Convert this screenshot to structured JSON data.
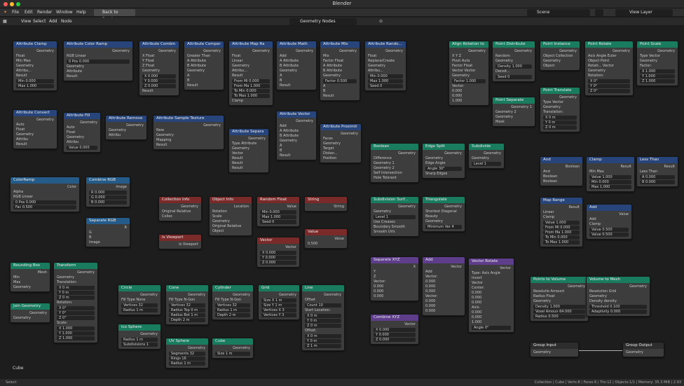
{
  "window": {
    "title": "Blender"
  },
  "menubar": {
    "items": [
      "File",
      "Edit",
      "Render",
      "Window",
      "Help"
    ],
    "back_button": "Back to Previous",
    "scene": "Scene",
    "view_layer": "View Layer"
  },
  "editor": {
    "menus": [
      "View",
      "Select",
      "Add",
      "Node"
    ],
    "node_tree": "Geometry Nodes"
  },
  "canvas": {
    "object_label": "Cube"
  },
  "status": {
    "left": "Select",
    "right": "Collection | Cube | Verts:8 | Faces:6 | Tris:12 | Objects:1/1 | Memory: 35.3 MiB | 2.93"
  },
  "nodes": [
    {
      "title": "Attribute Clamp",
      "type": "attr",
      "rows": [
        "Geometry",
        "Float",
        "Min Max",
        "Geometry",
        "Attribu...",
        "Result",
        "Min  0.000",
        "Max  1.000"
      ]
    },
    {
      "title": "Attribute Color Ramp",
      "type": "attr",
      "rows": [
        "Geometry",
        "RGB  Linear",
        "0  Pos  0.000",
        "Geometry",
        "Attribute",
        "Result"
      ]
    },
    {
      "title": "Attribute Combin",
      "type": "attr",
      "rows": [
        "Geometry",
        "X  Float",
        "Y  Float",
        "Z  Float",
        "Geometry",
        "X  0.000",
        "Y  0.000",
        "Z  0.000",
        "Result"
      ]
    },
    {
      "title": "Attribute Compar",
      "type": "attr",
      "rows": [
        "Geometry",
        "Greater Than",
        "A  Attribute",
        "B  Attribute",
        "Geometry",
        "A",
        "B",
        "Result"
      ]
    },
    {
      "title": "Attribute Map Ra",
      "type": "attr",
      "rows": [
        "Geometry",
        "Float",
        "Linear",
        "Geometry",
        "Attribu...",
        "Result",
        "From Mi  0.000",
        "From Ma  1.000",
        "To Min  0.000",
        "To Max  1.000",
        "Clamp"
      ]
    },
    {
      "title": "Attribute Math",
      "type": "attr",
      "rows": [
        "Geometry",
        "Add",
        "A  Attribute",
        "B  Attribute",
        "Geometry",
        "A",
        "B",
        "Result"
      ]
    },
    {
      "title": "Attribute Mix",
      "type": "attr",
      "rows": [
        "Geometry",
        "Mix",
        "Factor  Float",
        "A  Attribute",
        "B  Attribute",
        "Geometry",
        "Factor  0.500",
        "A",
        "B",
        "Result"
      ]
    },
    {
      "title": "Attribute Rando...",
      "type": "attr",
      "rows": [
        "Geometry",
        "Float",
        "Replace/Create",
        "Geometry",
        "Attribu...",
        "Min  0.000",
        "Max  1.000",
        "Seed  0"
      ]
    },
    {
      "title": "Align Rotation to",
      "type": "geo",
      "rows": [
        "Geometry",
        "X  Y  Z",
        "Pivot  Auto",
        "Factor  Float",
        "Vector  Vector",
        "Geometry",
        "Factor  1.000",
        "Vector:",
        "0.000",
        "0.000",
        "1.000"
      ]
    },
    {
      "title": "Point Distribute",
      "type": "geo",
      "rows": [
        "Geometry",
        "Random",
        "Geometry",
        "Density  1.000",
        "Densit...",
        "Seed  0"
      ]
    },
    {
      "title": "Point Instance",
      "type": "geo",
      "rows": [
        "Geometry",
        "Object  Collection",
        "Geometry",
        "Object"
      ]
    },
    {
      "title": "Point Rotate",
      "type": "geo",
      "rows": [
        "Geometry",
        "Axis Angle  Euler",
        "Object  Point",
        "Rotati...  Vector",
        "Geometry",
        "Rotation:",
        "X  0°",
        "Y  0°",
        "Z  0°"
      ]
    },
    {
      "title": "Point Scale",
      "type": "geo",
      "rows": [
        "Geometry",
        "Type  Vector",
        "Geometry",
        "Factor:",
        "X  1.000",
        "Y  1.000",
        "Z  1.000"
      ]
    },
    {
      "title": "Point Translate",
      "type": "geo",
      "rows": [
        "Geometry",
        "Type  Vector",
        "Geometry",
        "Translation:",
        "X  0 m",
        "Y  0 m",
        "Z  0 m"
      ]
    },
    {
      "title": "Point Separate",
      "type": "geo",
      "rows": [
        "Geometry 1",
        "Geometry 2",
        "Geometry",
        "Mask"
      ]
    },
    {
      "title": "Attribute Convert",
      "type": "attr",
      "rows": [
        "Geometry",
        "Auto",
        "Float",
        "Geometry",
        "Attribu",
        "Result"
      ]
    },
    {
      "title": "Attribute Fill",
      "type": "attr",
      "rows": [
        "Geometry",
        "Auto",
        "Float",
        "Geometry",
        "Attribu",
        "Value  0.000"
      ]
    },
    {
      "title": "Attribute Remove",
      "type": "attr",
      "rows": [
        "Geometry",
        "Geometry",
        "Attribu"
      ]
    },
    {
      "title": "Attribute Sample Texture",
      "type": "attr",
      "rows": [
        "Geometry",
        "New",
        "Geometry",
        "Mapping",
        "Result"
      ]
    },
    {
      "title": "Attribute Separa",
      "type": "attr",
      "rows": [
        "Geometry",
        "Type  Attribute",
        "Geometry",
        "Vector",
        "Result",
        "Result",
        "Result"
      ]
    },
    {
      "title": "Attribute Vector",
      "type": "attr",
      "rows": [
        "Geometry",
        "Add",
        "A  Attribute",
        "B  Attribute",
        "Geometry",
        "A",
        "B",
        "Result"
      ]
    },
    {
      "title": "Attribute Proximit",
      "type": "attr",
      "rows": [
        "Geometry",
        "Faces",
        "Geometry",
        "Target",
        "Distan...",
        "Position"
      ]
    },
    {
      "title": "Boolean",
      "type": "geo",
      "rows": [
        "Geometry",
        "Difference",
        "Geometry 1",
        "Geometry 2",
        "Self Intersection",
        "Hole Tolerant"
      ]
    },
    {
      "title": "Edge Split",
      "type": "geo",
      "rows": [
        "Geometry",
        "Geometry",
        "Edge Angle",
        "Angle  30°",
        "Sharp Edges"
      ]
    },
    {
      "title": "Subdivide",
      "type": "geo",
      "rows": [
        "Geometry",
        "Geometry",
        "Level  1"
      ]
    },
    {
      "title": "Subdivision Surf...",
      "type": "geo",
      "rows": [
        "Geometry",
        "Geometry",
        "Level  1",
        "Use Creases",
        "Boundary Smooth",
        "Smooth UVs"
      ]
    },
    {
      "title": "Triangulate",
      "type": "geo",
      "rows": [
        "Geometry",
        "Shortest Diagonal",
        "Beauty",
        "Geometry",
        "Minimum Ver  4"
      ]
    },
    {
      "title": "ColorRamp",
      "type": "conv",
      "rows": [
        "Color",
        "Alpha",
        "RGB  Linear",
        "0  Pos  0.000",
        "Fac  0.500"
      ]
    },
    {
      "title": "Combine RGB",
      "type": "conv",
      "rows": [
        "Image",
        "R  0.000",
        "G  0.000",
        "B  0.000"
      ]
    },
    {
      "title": "Separate RGB",
      "type": "conv",
      "rows": [
        "R",
        "G",
        "B",
        "Image"
      ]
    },
    {
      "title": "Collection Info",
      "type": "input",
      "rows": [
        "Geometry",
        "Original  Relative",
        "Collec"
      ]
    },
    {
      "title": "Object Info",
      "type": "input",
      "rows": [
        "Location",
        "Rotation",
        "Scale",
        "Geometry",
        "Original  Relative",
        "Object"
      ]
    },
    {
      "title": "Random Float",
      "type": "input",
      "rows": [
        "Value",
        "Min  0.000",
        "Max  1.000",
        "Seed  0"
      ]
    },
    {
      "title": "String",
      "type": "input",
      "rows": [
        "String"
      ]
    },
    {
      "title": "Is Viewport",
      "type": "input",
      "rows": [
        "Is Viewport"
      ]
    },
    {
      "title": "Vector",
      "type": "input",
      "rows": [
        "Vector",
        "X  0.000",
        "Y  0.000",
        "Z  0.000"
      ]
    },
    {
      "title": "Value",
      "type": "input",
      "rows": [
        "Value",
        "0.500"
      ]
    },
    {
      "title": "Separate XYZ",
      "type": "vector",
      "rows": [
        "X",
        "Y",
        "Z",
        "Vector:",
        "0.000",
        "0.000",
        "0.000"
      ]
    },
    {
      "title": "Add",
      "type": "vector",
      "rows": [
        "Vector",
        "Add",
        "Vector:",
        "0.000",
        "0.000",
        "0.000",
        "Vector:",
        "0.000",
        "0.000",
        "0.000"
      ]
    },
    {
      "title": "Vector Rotate",
      "type": "vector",
      "rows": [
        "Vector",
        "Type:  Axis Angle",
        "Invert",
        "Vector",
        "Center:",
        "0.000",
        "0.000",
        "0.000",
        "Axis:",
        "0.000",
        "0.000",
        "1.000",
        "Angle  0°"
      ]
    },
    {
      "title": "Combine XYZ",
      "type": "vector",
      "rows": [
        "Vector",
        "X  0.000",
        "Y  0.000",
        "Z  0.000"
      ]
    },
    {
      "title": "And",
      "type": "attr",
      "rows": [
        "Boolean",
        "And",
        "Boolean",
        "Boolean"
      ]
    },
    {
      "title": "Clamp",
      "type": "attr",
      "rows": [
        "Result",
        "Min Max",
        "Value  1.000",
        "Min  0.000",
        "Max  1.000"
      ]
    },
    {
      "title": "Less Than",
      "type": "attr",
      "rows": [
        "Result",
        "Less Than",
        "A  0.000",
        "B  0.000"
      ]
    },
    {
      "title": "Map Range",
      "type": "attr",
      "rows": [
        "Result",
        "Linear",
        "Clamp",
        "Value  1.000",
        "From Mi  0.000",
        "From Ma  1.000",
        "To Min  0.000",
        "To Max  1.000"
      ]
    },
    {
      "title": "Add",
      "type": "attr",
      "rows": [
        "Value",
        "Add",
        "Clamp",
        "Value  0.500",
        "Value  0.500"
      ]
    },
    {
      "title": "Points to Volume",
      "type": "geo",
      "rows": [
        "Geometry",
        "Resolutio  Amount",
        "Radius  Float",
        "Geometry",
        "Density  1.000",
        "Voxel Amoun  64.000",
        "Radius  0.500"
      ]
    },
    {
      "title": "Volume to Mesh",
      "type": "geo",
      "rows": [
        "Geometry",
        "Resolution  Grid",
        "Geometry",
        "Density  density",
        "Threshold  0.100",
        "Adaptivity  0.000"
      ]
    },
    {
      "title": "Bounding Box",
      "type": "geo",
      "rows": [
        "Mesh",
        "Min",
        "Max",
        "Geometry"
      ]
    },
    {
      "title": "Join Geometry",
      "type": "geo",
      "rows": [
        "Geometry",
        "Geometry"
      ]
    },
    {
      "title": "Transform",
      "type": "geo",
      "rows": [
        "Geometry",
        "Geometry",
        "Translation:",
        "X  0 m",
        "Y  0 m",
        "Z  0 m",
        "Rotation:",
        "X  0°",
        "Y  0°",
        "Z  0°",
        "Scale:",
        "X  1.000",
        "Y  1.000",
        "Z  1.000"
      ]
    },
    {
      "title": "Circle",
      "type": "geo",
      "rows": [
        "Geometry",
        "Fill Type  None",
        "Vertices  32",
        "Radius  1 m"
      ]
    },
    {
      "title": "Ico Sphere",
      "type": "geo",
      "rows": [
        "Geometry",
        "Radius  1 m",
        "Subdivisions  1"
      ]
    },
    {
      "title": "Cone",
      "type": "geo",
      "rows": [
        "Geometry",
        "Fill Type  N-Gon",
        "Vertices  32",
        "Radius Top  0 m",
        "Radius Bot  1 m",
        "Depth  2 m"
      ]
    },
    {
      "title": "UV Sphere",
      "type": "geo",
      "rows": [
        "Geometry",
        "Segments  32",
        "Rings  16",
        "Radius  1 m"
      ]
    },
    {
      "title": "Cylinder",
      "type": "geo",
      "rows": [
        "Geometry",
        "Fill Type  N-Gon",
        "Vertices  32",
        "Radius  1 m",
        "Depth  2 m"
      ]
    },
    {
      "title": "Cube",
      "type": "geo",
      "rows": [
        "Geometry",
        "Size  1 m"
      ]
    },
    {
      "title": "Grid",
      "type": "geo",
      "rows": [
        "Geometry",
        "Size X  1 m",
        "Size Y  1 m",
        "Vertices X  3",
        "Vertices Y  3"
      ]
    },
    {
      "title": "Line",
      "type": "geo",
      "rows": [
        "Geometry",
        "Offset",
        "Count  10",
        "Start Location:",
        "X  0 m",
        "Y  0 m",
        "Z  0 m",
        "Offset:",
        "X  0 m",
        "Y  0 m",
        "Z  1 m"
      ]
    },
    {
      "title": "Group Input",
      "type": "group",
      "rows": [
        "Geometry"
      ]
    },
    {
      "title": "Group Output",
      "type": "group",
      "rows": [
        "Geometry"
      ]
    }
  ]
}
